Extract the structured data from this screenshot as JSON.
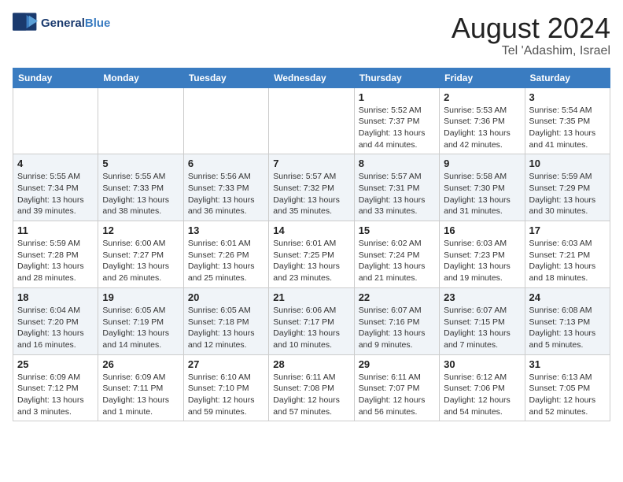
{
  "header": {
    "logo_general": "General",
    "logo_blue": "Blue",
    "title": "August 2024",
    "subtitle": "Tel 'Adashim, Israel"
  },
  "days_of_week": [
    "Sunday",
    "Monday",
    "Tuesday",
    "Wednesday",
    "Thursday",
    "Friday",
    "Saturday"
  ],
  "weeks": [
    {
      "cells": [
        {
          "day": "",
          "info": ""
        },
        {
          "day": "",
          "info": ""
        },
        {
          "day": "",
          "info": ""
        },
        {
          "day": "",
          "info": ""
        },
        {
          "day": "1",
          "info": "Sunrise: 5:52 AM\nSunset: 7:37 PM\nDaylight: 13 hours\nand 44 minutes."
        },
        {
          "day": "2",
          "info": "Sunrise: 5:53 AM\nSunset: 7:36 PM\nDaylight: 13 hours\nand 42 minutes."
        },
        {
          "day": "3",
          "info": "Sunrise: 5:54 AM\nSunset: 7:35 PM\nDaylight: 13 hours\nand 41 minutes."
        }
      ]
    },
    {
      "cells": [
        {
          "day": "4",
          "info": "Sunrise: 5:55 AM\nSunset: 7:34 PM\nDaylight: 13 hours\nand 39 minutes."
        },
        {
          "day": "5",
          "info": "Sunrise: 5:55 AM\nSunset: 7:33 PM\nDaylight: 13 hours\nand 38 minutes."
        },
        {
          "day": "6",
          "info": "Sunrise: 5:56 AM\nSunset: 7:33 PM\nDaylight: 13 hours\nand 36 minutes."
        },
        {
          "day": "7",
          "info": "Sunrise: 5:57 AM\nSunset: 7:32 PM\nDaylight: 13 hours\nand 35 minutes."
        },
        {
          "day": "8",
          "info": "Sunrise: 5:57 AM\nSunset: 7:31 PM\nDaylight: 13 hours\nand 33 minutes."
        },
        {
          "day": "9",
          "info": "Sunrise: 5:58 AM\nSunset: 7:30 PM\nDaylight: 13 hours\nand 31 minutes."
        },
        {
          "day": "10",
          "info": "Sunrise: 5:59 AM\nSunset: 7:29 PM\nDaylight: 13 hours\nand 30 minutes."
        }
      ]
    },
    {
      "cells": [
        {
          "day": "11",
          "info": "Sunrise: 5:59 AM\nSunset: 7:28 PM\nDaylight: 13 hours\nand 28 minutes."
        },
        {
          "day": "12",
          "info": "Sunrise: 6:00 AM\nSunset: 7:27 PM\nDaylight: 13 hours\nand 26 minutes."
        },
        {
          "day": "13",
          "info": "Sunrise: 6:01 AM\nSunset: 7:26 PM\nDaylight: 13 hours\nand 25 minutes."
        },
        {
          "day": "14",
          "info": "Sunrise: 6:01 AM\nSunset: 7:25 PM\nDaylight: 13 hours\nand 23 minutes."
        },
        {
          "day": "15",
          "info": "Sunrise: 6:02 AM\nSunset: 7:24 PM\nDaylight: 13 hours\nand 21 minutes."
        },
        {
          "day": "16",
          "info": "Sunrise: 6:03 AM\nSunset: 7:23 PM\nDaylight: 13 hours\nand 19 minutes."
        },
        {
          "day": "17",
          "info": "Sunrise: 6:03 AM\nSunset: 7:21 PM\nDaylight: 13 hours\nand 18 minutes."
        }
      ]
    },
    {
      "cells": [
        {
          "day": "18",
          "info": "Sunrise: 6:04 AM\nSunset: 7:20 PM\nDaylight: 13 hours\nand 16 minutes."
        },
        {
          "day": "19",
          "info": "Sunrise: 6:05 AM\nSunset: 7:19 PM\nDaylight: 13 hours\nand 14 minutes."
        },
        {
          "day": "20",
          "info": "Sunrise: 6:05 AM\nSunset: 7:18 PM\nDaylight: 13 hours\nand 12 minutes."
        },
        {
          "day": "21",
          "info": "Sunrise: 6:06 AM\nSunset: 7:17 PM\nDaylight: 13 hours\nand 10 minutes."
        },
        {
          "day": "22",
          "info": "Sunrise: 6:07 AM\nSunset: 7:16 PM\nDaylight: 13 hours\nand 9 minutes."
        },
        {
          "day": "23",
          "info": "Sunrise: 6:07 AM\nSunset: 7:15 PM\nDaylight: 13 hours\nand 7 minutes."
        },
        {
          "day": "24",
          "info": "Sunrise: 6:08 AM\nSunset: 7:13 PM\nDaylight: 13 hours\nand 5 minutes."
        }
      ]
    },
    {
      "cells": [
        {
          "day": "25",
          "info": "Sunrise: 6:09 AM\nSunset: 7:12 PM\nDaylight: 13 hours\nand 3 minutes."
        },
        {
          "day": "26",
          "info": "Sunrise: 6:09 AM\nSunset: 7:11 PM\nDaylight: 13 hours\nand 1 minute."
        },
        {
          "day": "27",
          "info": "Sunrise: 6:10 AM\nSunset: 7:10 PM\nDaylight: 12 hours\nand 59 minutes."
        },
        {
          "day": "28",
          "info": "Sunrise: 6:11 AM\nSunset: 7:08 PM\nDaylight: 12 hours\nand 57 minutes."
        },
        {
          "day": "29",
          "info": "Sunrise: 6:11 AM\nSunset: 7:07 PM\nDaylight: 12 hours\nand 56 minutes."
        },
        {
          "day": "30",
          "info": "Sunrise: 6:12 AM\nSunset: 7:06 PM\nDaylight: 12 hours\nand 54 minutes."
        },
        {
          "day": "31",
          "info": "Sunrise: 6:13 AM\nSunset: 7:05 PM\nDaylight: 12 hours\nand 52 minutes."
        }
      ]
    }
  ]
}
